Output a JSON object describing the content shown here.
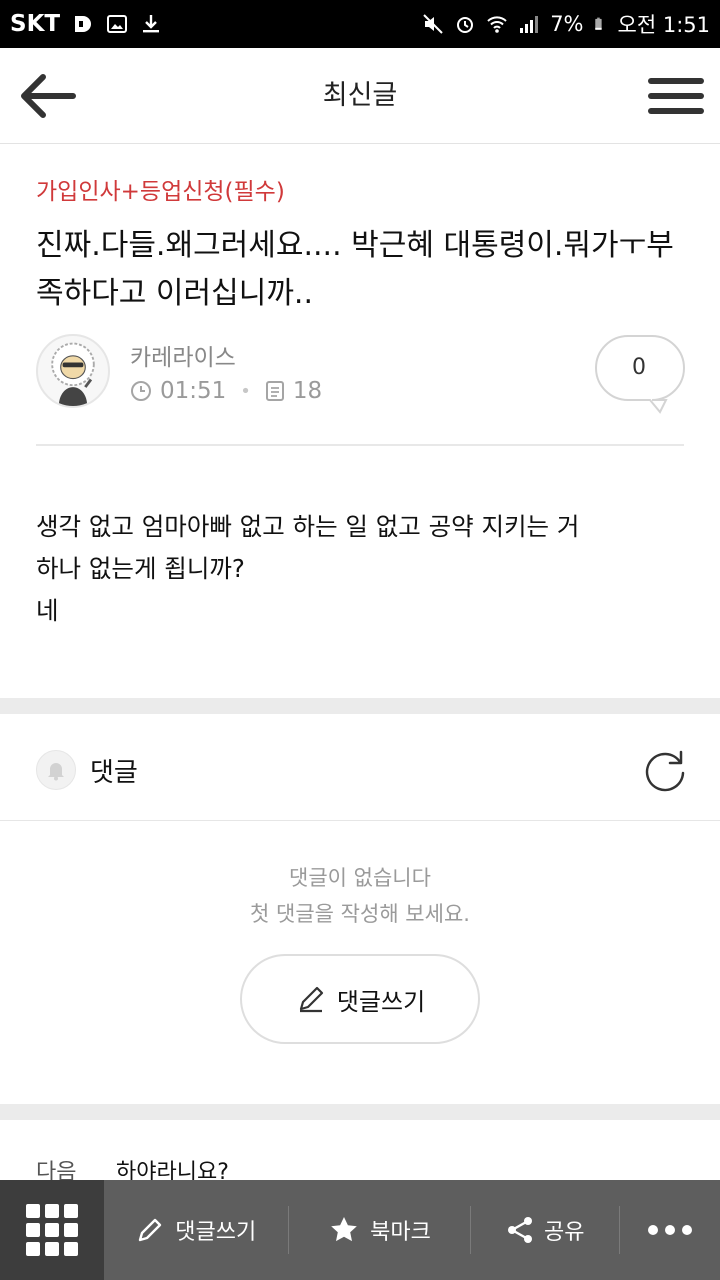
{
  "status_bar": {
    "carrier": "SKT",
    "battery": "7%",
    "time": "오전 1:51"
  },
  "app_bar": {
    "title": "최신글"
  },
  "post": {
    "category": "가입인사+등업신청(필수)",
    "title": "진짜.다들.왜그러세요.... 박근혜 대통령이.뭐가ㅜ부족하다고 이러십니까..",
    "author": "카레라이스",
    "time": "01:51",
    "views": "18",
    "comment_count": "0",
    "body_lines": [
      "생각 없고 엄마아빠 없고 하는 일 없고 공약 지키는 거",
      "하나 없는게 죕니까?",
      "네"
    ]
  },
  "comments": {
    "label": "댓글",
    "empty_line1": "댓글이 없습니다",
    "empty_line2": "첫 댓글을 작성해 보세요.",
    "write_button": "댓글쓰기"
  },
  "next_post": {
    "label": "다음",
    "title": "하야라니요?"
  },
  "bottom_bar": {
    "comment": "댓글쓰기",
    "bookmark": "북마크",
    "share": "공유"
  },
  "colors": {
    "category": "#d0393a",
    "bottom_bar": "#5e5e5e",
    "bottom_grid": "#3d3d3d"
  },
  "icons": [
    "back-arrow-icon",
    "hamburger-menu-icon",
    "clock-icon",
    "document-icon",
    "speech-bubble-icon",
    "bell-icon",
    "refresh-icon",
    "pencil-icon",
    "grid-icon",
    "star-icon",
    "share-icon",
    "more-icon"
  ]
}
